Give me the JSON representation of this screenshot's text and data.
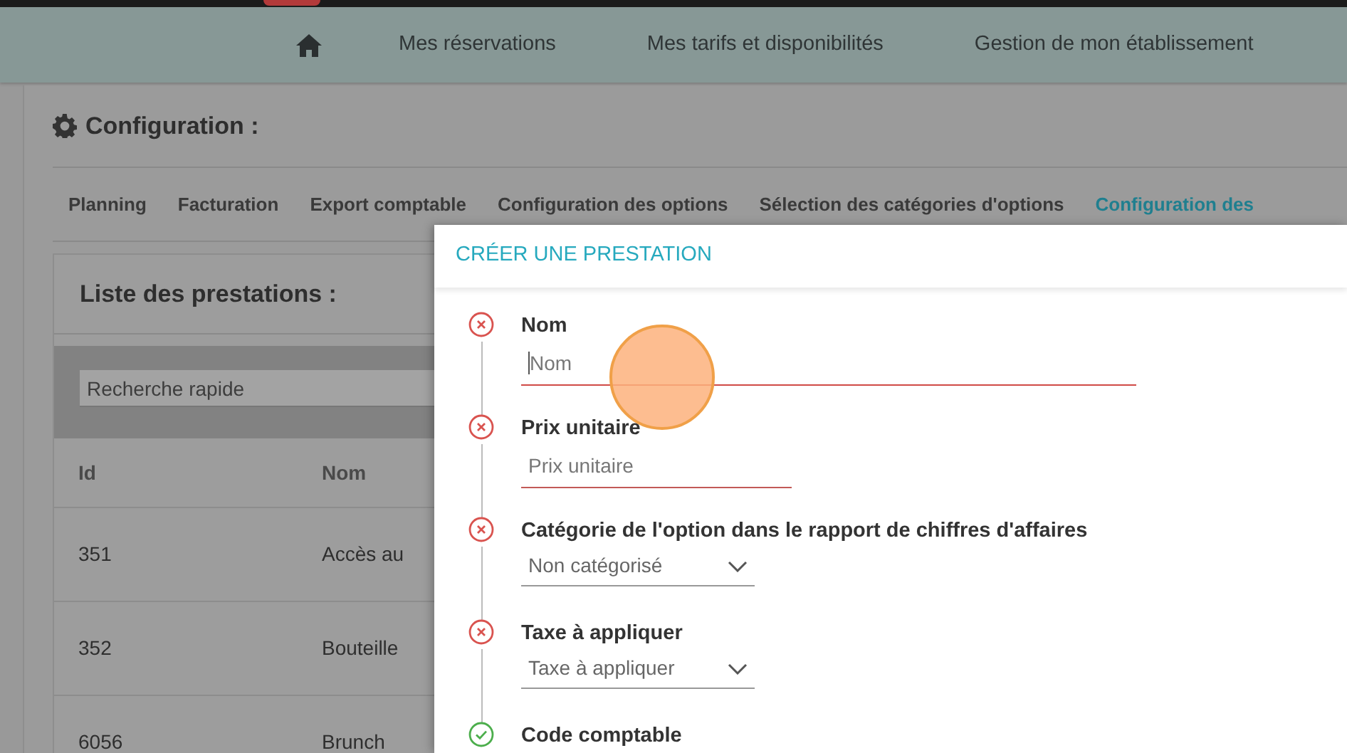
{
  "nav": {
    "items": [
      {
        "kind": "home"
      },
      {
        "kind": "link",
        "label": "Mes réservations"
      },
      {
        "kind": "link",
        "label": "Mes tarifs et disponibilités"
      },
      {
        "kind": "link",
        "label": "Gestion de mon établissement"
      }
    ]
  },
  "page": {
    "title": "Configuration :",
    "tabs": [
      {
        "label": "Planning",
        "selected": false
      },
      {
        "label": "Facturation",
        "selected": false
      },
      {
        "label": "Export comptable",
        "selected": false
      },
      {
        "label": "Configuration des options",
        "selected": false
      },
      {
        "label": "Sélection des catégories d'options",
        "selected": false
      },
      {
        "label": "Configuration des",
        "selected": true
      }
    ]
  },
  "list": {
    "title": "Liste des prestations :",
    "search": {
      "placeholder": "Recherche rapide"
    },
    "columns": [
      "Id",
      "Nom"
    ],
    "rows": [
      [
        "351",
        "Accès au"
      ],
      [
        "352",
        "Bouteille"
      ],
      [
        "6056",
        "Brunch"
      ]
    ]
  },
  "modal": {
    "title": "CRÉER UNE PRESTATION",
    "steps": [
      {
        "label": "Nom",
        "valid": false,
        "kind": "input",
        "placeholder": "Nom",
        "focused": true
      },
      {
        "label": "Prix unitaire",
        "valid": false,
        "kind": "input",
        "placeholder": "Prix unitaire",
        "focused": false
      },
      {
        "label": "Catégorie de l'option dans le rapport de chiffres d'affaires",
        "valid": false,
        "kind": "select",
        "value": "Non catégorisé"
      },
      {
        "label": "Taxe à appliquer",
        "valid": false,
        "kind": "select",
        "value": "Taxe à appliquer"
      },
      {
        "label": "Code comptable",
        "valid": true,
        "kind": "none"
      }
    ]
  }
}
